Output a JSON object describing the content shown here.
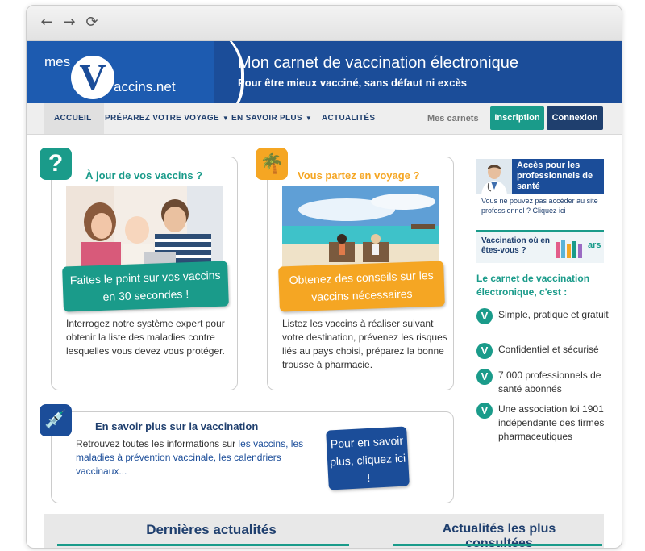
{
  "browser": {
    "back_icon": "←",
    "forward_icon": "→",
    "reload_icon": "⟳"
  },
  "logo": {
    "mes": "mes",
    "v": "V",
    "vaccins": "accins.net"
  },
  "banner": {
    "title": "Mon carnet de vaccination électronique",
    "subtitle": "Pour être mieux vacciné, sans défaut ni excès"
  },
  "menu": {
    "items": [
      {
        "label": "ACCUEIL"
      },
      {
        "label": "PRÉPAREZ VOTRE VOYAGE"
      },
      {
        "label": "EN SAVOIR PLUS"
      },
      {
        "label": "ACTUALITÉS"
      }
    ],
    "mes_carnets": "Mes carnets",
    "inscription": "Inscription",
    "connexion": "Connexion"
  },
  "cards": {
    "vaccins": {
      "icon": "?",
      "title": "À jour de vos vaccins ?",
      "cta": "Faites le point sur vos vaccins en 30 secondes !",
      "text": "Interrogez notre système expert pour obtenir la liste des maladies contre lesquelles vous devez vous protéger."
    },
    "voyage": {
      "icon": "🌴",
      "title": "Vous partez en voyage ?",
      "cta": "Obtenez des conseils sur les vaccins nécessaires",
      "text": "Listez les vaccins à réaliser suivant votre destination, prévenez les risques liés au pays choisi, préparez la bonne trousse à pharmacie."
    },
    "savoir": {
      "icon": "💉",
      "title": "En savoir plus sur la vaccination",
      "text_prefix": "Retrouvez toutes les informations sur ",
      "link1": "les vaccins,",
      "link2": "les maladies à prévention vaccinale, les calendriers vaccinaux...",
      "cta": "Pour en savoir plus, cliquez ici !"
    }
  },
  "sidebar": {
    "pro_title": "Accès pour les professionnels de santé",
    "pro_sub": "Vous ne pouvez pas accéder au site professionnel ? Cliquez ici",
    "vac_banner": "Vaccination où en êtes-vous ?",
    "ars": "ars",
    "carnet_title": "Le carnet de vaccination électronique, c'est :",
    "features": [
      "Simple, pratique et gratuit",
      "Confidentiel et sécurisé",
      "7 000 professionnels de santé abonnés",
      "Une association loi 1901 indépendante des firmes pharmaceutiques"
    ]
  },
  "news": {
    "latest": "Dernières actualités",
    "most_viewed": "Actualités les plus consultées"
  },
  "colors": {
    "brand_blue": "#1b4d99",
    "teal": "#1a9b8a",
    "orange": "#f5a623",
    "navy": "#1f3f6e"
  }
}
